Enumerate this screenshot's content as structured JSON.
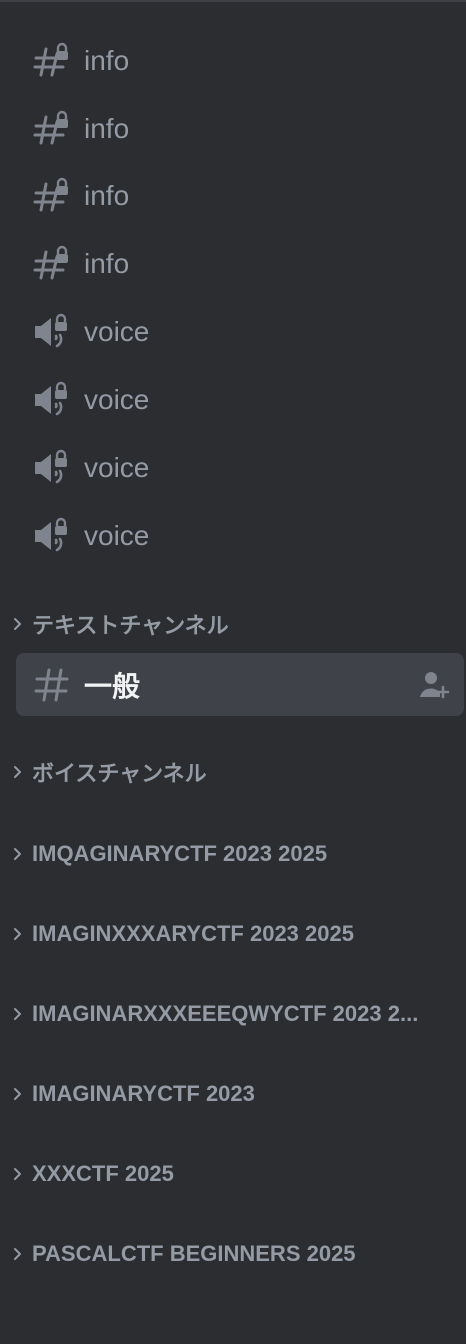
{
  "channels": [
    {
      "label": "info",
      "icon": "locked-text-channel-icon"
    },
    {
      "label": "info",
      "icon": "locked-text-channel-icon"
    },
    {
      "label": "info",
      "icon": "locked-text-channel-icon"
    },
    {
      "label": "info",
      "icon": "locked-text-channel-icon"
    },
    {
      "label": "voice",
      "icon": "locked-voice-channel-icon"
    },
    {
      "label": "voice",
      "icon": "locked-voice-channel-icon"
    },
    {
      "label": "voice",
      "icon": "locked-voice-channel-icon"
    },
    {
      "label": "voice",
      "icon": "locked-voice-channel-icon"
    }
  ],
  "categories": [
    {
      "label": "テキストチャンネル"
    },
    {
      "label": "ボイスチャンネル"
    },
    {
      "label": "IMQAGINARYCTF 2023 2025"
    },
    {
      "label": "IMAGINXXXARYCTF 2023 2025"
    },
    {
      "label": "IMAGINARXXXEEEQWYCTF 2023 2..."
    },
    {
      "label": "IMAGINARYCTF 2023"
    },
    {
      "label": "XXXCTF 2025"
    },
    {
      "label": "PASCALCTF BEGINNERS 2025"
    }
  ],
  "active_channel": {
    "label": "一般",
    "icon": "text-channel-icon",
    "action_icon": "create-invite-icon"
  },
  "colors": {
    "background": "#2b2d31",
    "active_background": "#3f4248",
    "muted_text": "#949ba4",
    "icon": "#80848e",
    "active_text": "#f2f3f5"
  }
}
